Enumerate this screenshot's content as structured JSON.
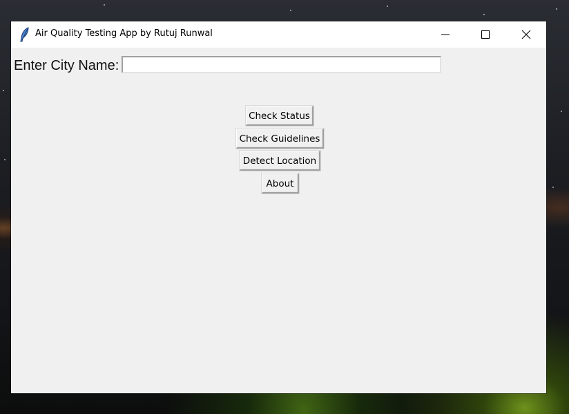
{
  "window": {
    "title": "Air Quality Testing App by Rutuj Runwal",
    "controls": {
      "minimize_icon": "minimize-icon",
      "maximize_icon": "maximize-icon",
      "close_icon": "close-icon"
    },
    "app_icon": "feather-icon"
  },
  "form": {
    "city_label": "Enter City Name:",
    "city_value": "",
    "city_placeholder": ""
  },
  "buttons": {
    "check_status": "Check Status",
    "check_guidelines": "Check Guidelines",
    "detect_location": "Detect Location",
    "about": "About"
  },
  "colors": {
    "window_bg": "#f0f0f0",
    "titlebar_bg": "#ffffff",
    "input_bg": "#ffffff"
  }
}
